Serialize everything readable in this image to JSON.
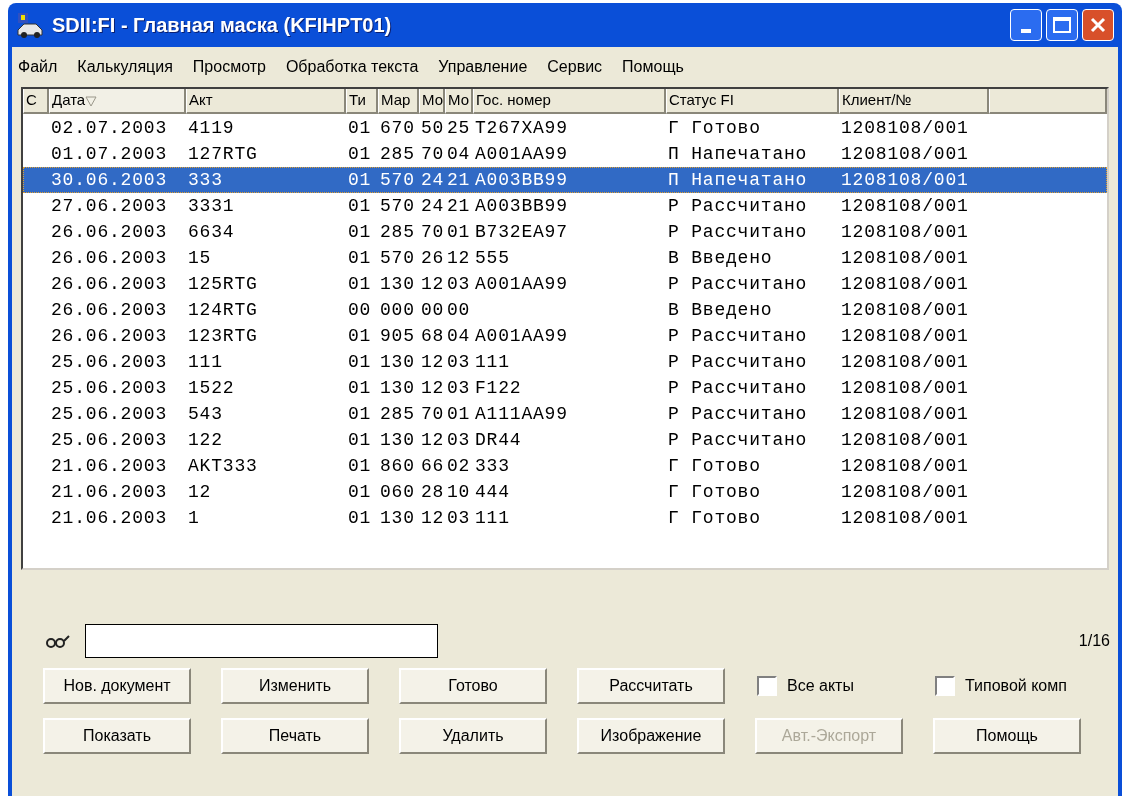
{
  "window": {
    "title": "SDII:FI - Главная маска (KFIHPT01)"
  },
  "menu": [
    "Файл",
    "Калькуляция",
    "Просмотр",
    "Обработка текста",
    "Управление",
    "Сервис",
    "Помощь"
  ],
  "table": {
    "columns": [
      {
        "label": "С",
        "sorted": false
      },
      {
        "label": "Дата",
        "sorted": true
      },
      {
        "label": "Акт",
        "sorted": false
      },
      {
        "label": "Ти",
        "sorted": false
      },
      {
        "label": "Мар",
        "sorted": false
      },
      {
        "label": "Мо",
        "sorted": false
      },
      {
        "label": "Мо",
        "sorted": false
      },
      {
        "label": "Гос. номер",
        "sorted": false
      },
      {
        "label": "Статус FI",
        "sorted": false
      },
      {
        "label": "Клиент/№",
        "sorted": false
      }
    ],
    "rows": [
      {
        "cells": [
          "",
          "02.07.2003",
          "4119",
          "01",
          "670",
          "50",
          "25",
          "T267XA99",
          "Г Готово",
          "1208108/001"
        ],
        "selected": false
      },
      {
        "cells": [
          "",
          "01.07.2003",
          "127RTG",
          "01",
          "285",
          "70",
          "04",
          "A001AA99",
          "П Напечатано",
          "1208108/001"
        ],
        "selected": false
      },
      {
        "cells": [
          "",
          "30.06.2003",
          "333",
          "01",
          "570",
          "24",
          "21",
          "A003BB99",
          "П Напечатано",
          "1208108/001"
        ],
        "selected": true
      },
      {
        "cells": [
          "",
          "27.06.2003",
          "3331",
          "01",
          "570",
          "24",
          "21",
          "A003BB99",
          "Р Рассчитано",
          "1208108/001"
        ],
        "selected": false
      },
      {
        "cells": [
          "",
          "26.06.2003",
          "6634",
          "01",
          "285",
          "70",
          "01",
          "B732EA97",
          "Р Рассчитано",
          "1208108/001"
        ],
        "selected": false
      },
      {
        "cells": [
          "",
          "26.06.2003",
          "15",
          "01",
          "570",
          "26",
          "12",
          "555",
          "В Введено",
          "1208108/001"
        ],
        "selected": false
      },
      {
        "cells": [
          "",
          "26.06.2003",
          "125RTG",
          "01",
          "130",
          "12",
          "03",
          "A001AA99",
          "Р Рассчитано",
          "1208108/001"
        ],
        "selected": false
      },
      {
        "cells": [
          "",
          "26.06.2003",
          "124RTG",
          "00",
          "000",
          "00",
          "00",
          "",
          "В Введено",
          "1208108/001"
        ],
        "selected": false
      },
      {
        "cells": [
          "",
          "26.06.2003",
          "123RTG",
          "01",
          "905",
          "68",
          "04",
          "A001AA99",
          "Р Рассчитано",
          "1208108/001"
        ],
        "selected": false
      },
      {
        "cells": [
          "",
          "25.06.2003",
          "111",
          "01",
          "130",
          "12",
          "03",
          "111",
          "Р Рассчитано",
          "1208108/001"
        ],
        "selected": false
      },
      {
        "cells": [
          "",
          "25.06.2003",
          "1522",
          "01",
          "130",
          "12",
          "03",
          "F122",
          "Р Рассчитано",
          "1208108/001"
        ],
        "selected": false
      },
      {
        "cells": [
          "",
          "25.06.2003",
          "543",
          "01",
          "285",
          "70",
          "01",
          "A111AA99",
          "Р Рассчитано",
          "1208108/001"
        ],
        "selected": false
      },
      {
        "cells": [
          "",
          "25.06.2003",
          "122",
          "01",
          "130",
          "12",
          "03",
          "DR44",
          "Р Рассчитано",
          "1208108/001"
        ],
        "selected": false
      },
      {
        "cells": [
          "",
          "21.06.2003",
          "AKT333",
          "01",
          "860",
          "66",
          "02",
          "333",
          "Г Готово",
          "1208108/001"
        ],
        "selected": false
      },
      {
        "cells": [
          "",
          "21.06.2003",
          "12",
          "01",
          "060",
          "28",
          "10",
          "444",
          "Г Готово",
          "1208108/001"
        ],
        "selected": false
      },
      {
        "cells": [
          "",
          "21.06.2003",
          "1",
          "01",
          "130",
          "12",
          "03",
          "111",
          "Г Готово",
          "1208108/001"
        ],
        "selected": false
      }
    ]
  },
  "counter": "1/16",
  "controls": [
    [
      {
        "kind": "button",
        "label": "Нов. документ",
        "disabled": false
      },
      {
        "kind": "button",
        "label": "Изменить",
        "disabled": false
      },
      {
        "kind": "button",
        "label": "Готово",
        "disabled": false
      },
      {
        "kind": "button",
        "label": "Рассчитать",
        "disabled": false
      },
      {
        "kind": "checkbox",
        "label": "Все акты",
        "checked": false
      },
      {
        "kind": "checkbox",
        "label": "Типовой комп",
        "checked": false
      }
    ],
    [
      {
        "kind": "button",
        "label": "Показать",
        "disabled": false
      },
      {
        "kind": "button",
        "label": "Печать",
        "disabled": false
      },
      {
        "kind": "button",
        "label": "Удалить",
        "disabled": false
      },
      {
        "kind": "button",
        "label": "Изображение",
        "disabled": false
      },
      {
        "kind": "button",
        "label": "Авт.-Экспорт",
        "disabled": true
      },
      {
        "kind": "button",
        "label": "Помощь",
        "disabled": false
      }
    ]
  ]
}
